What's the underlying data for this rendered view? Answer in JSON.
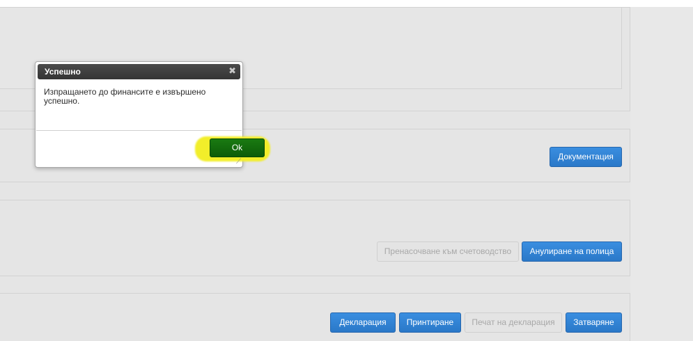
{
  "dialog": {
    "title": "Успешно",
    "close_glyph": "✖",
    "message": "Изпращането до финансите е извършено успешно.",
    "ok_label": "Ok",
    "resize_glyph": "⟋"
  },
  "panel_documentation": {
    "documentation_label": "Документация"
  },
  "panel_accounting": {
    "transfer_label": "Пренасочване към счетоводство",
    "cancel_policy_label": "Анулиране на полица"
  },
  "panel_footer": {
    "declaration_label": "Декларация",
    "print_label": "Принтиране",
    "print_declaration_label": "Печат на декларация",
    "close_label": "Затваряне"
  },
  "colors": {
    "primary": "#2a78c8",
    "ok_green": "#0d5c08",
    "highlight": "#f2ee2a",
    "backdrop": "#e5e5e5"
  }
}
